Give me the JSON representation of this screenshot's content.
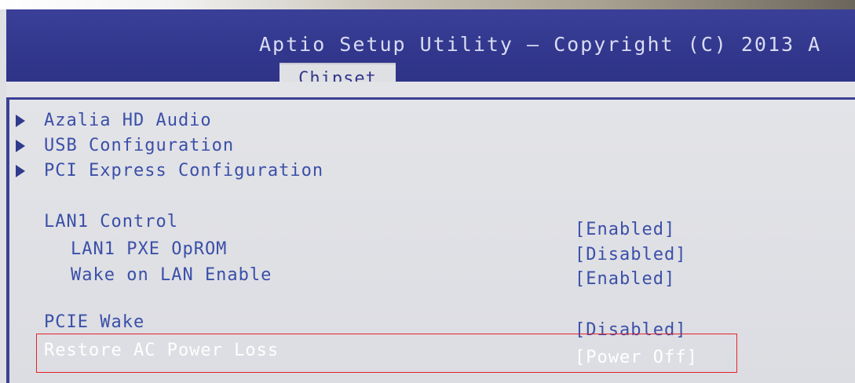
{
  "header": {
    "title": "Aptio Setup Utility – Copyright (C) 2013 A",
    "active_tab": "Chipset"
  },
  "menu": {
    "submenus": [
      {
        "label": "Azalia HD Audio"
      },
      {
        "label": "USB Configuration"
      },
      {
        "label": "PCI Express Configuration"
      }
    ],
    "settings": [
      {
        "label": "LAN1 Control",
        "value": "[Enabled]"
      },
      {
        "label": "LAN1 PXE OpROM",
        "value": "[Disabled]"
      },
      {
        "label": "Wake on LAN Enable",
        "value": "[Enabled]"
      },
      {
        "label": "PCIE Wake",
        "value": "[Disabled]"
      },
      {
        "label": "Restore AC Power Loss",
        "value": "[Power Off]"
      }
    ]
  },
  "colors": {
    "header_bg": "#3a3f98",
    "content_bg": "#dfe0e4",
    "text": "#3b4fa8",
    "selected_text": "#ffffff",
    "annotation_box": "#e4232a"
  },
  "icons": {
    "submenu_arrow": "triangle-right-icon"
  }
}
